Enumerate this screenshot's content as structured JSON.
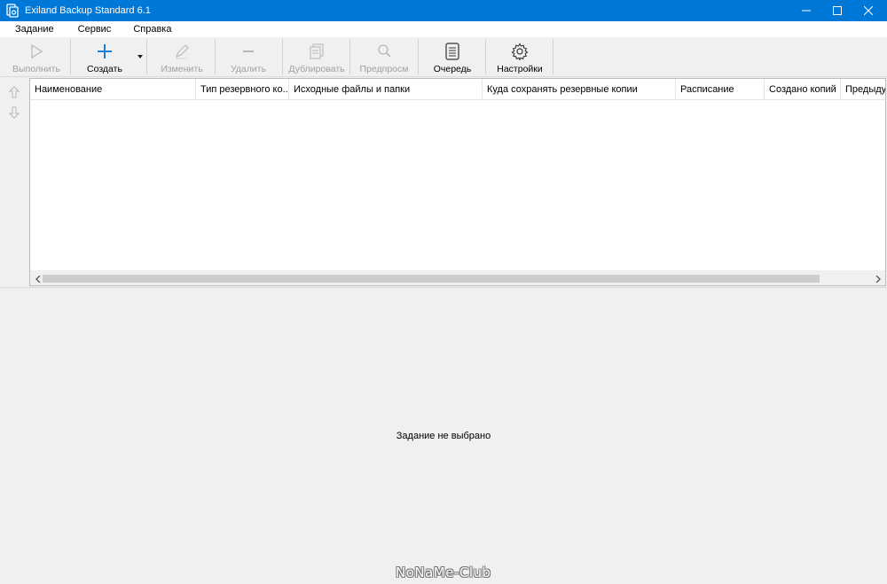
{
  "window": {
    "title": "Exiland Backup Standard 6.1",
    "title_bg": "#0078d7"
  },
  "menu": [
    "Задание",
    "Сервис",
    "Справка"
  ],
  "toolbar": {
    "run": "Выполнить",
    "create": "Создать",
    "edit": "Изменить",
    "delete": "Удалить",
    "duplicate": "Дублировать",
    "preview": "Предпросм",
    "queue": "Очередь",
    "settings": "Настройки",
    "accent_icon_color": "#1a7fd6"
  },
  "grid": {
    "columns": [
      "Наименование",
      "Тип резервного ко...",
      "Исходные файлы и папки",
      "Куда сохранять резервные копии",
      "Расписание",
      "Создано копий",
      "Предыдущ"
    ],
    "rows": []
  },
  "details": {
    "empty_text": "Задание не выбрано"
  },
  "watermark": "NoNaMe-Club"
}
